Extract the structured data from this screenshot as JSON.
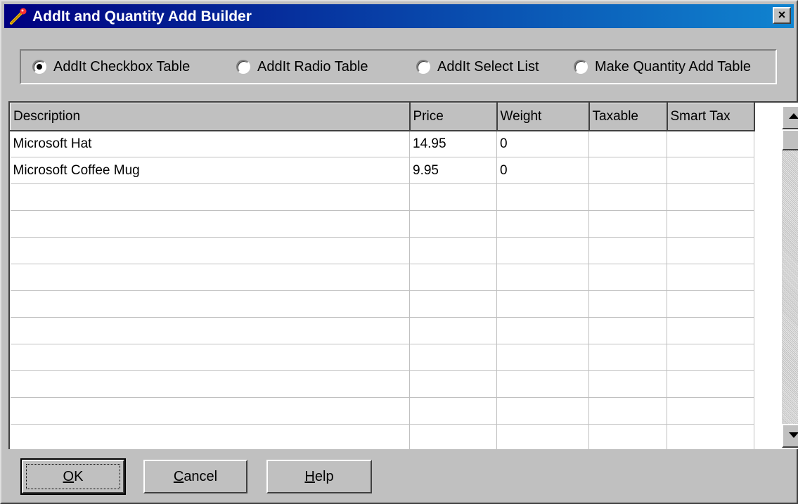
{
  "window": {
    "title": "AddIt and Quantity Add Builder",
    "close_label": "×"
  },
  "options": [
    {
      "label": "AddIt Checkbox Table",
      "selected": true
    },
    {
      "label": "AddIt Radio Table",
      "selected": false
    },
    {
      "label": "AddIt Select List",
      "selected": false
    },
    {
      "label": "Make Quantity Add Table",
      "selected": false
    }
  ],
  "grid": {
    "columns": [
      "Description",
      "Price",
      "Weight",
      "Taxable",
      "Smart Tax"
    ],
    "rows": [
      [
        "Microsoft Hat",
        "14.95",
        "0",
        "",
        ""
      ],
      [
        "Microsoft Coffee Mug",
        "9.95",
        "0",
        "",
        ""
      ],
      [
        "",
        "",
        "",
        "",
        ""
      ],
      [
        "",
        "",
        "",
        "",
        ""
      ],
      [
        "",
        "",
        "",
        "",
        ""
      ],
      [
        "",
        "",
        "",
        "",
        ""
      ],
      [
        "",
        "",
        "",
        "",
        ""
      ],
      [
        "",
        "",
        "",
        "",
        ""
      ],
      [
        "",
        "",
        "",
        "",
        ""
      ],
      [
        "",
        "",
        "",
        "",
        ""
      ],
      [
        "",
        "",
        "",
        "",
        ""
      ],
      [
        "",
        "",
        "",
        "",
        ""
      ]
    ]
  },
  "buttons": {
    "ok": "OK",
    "cancel": "Cancel",
    "help": "Help"
  }
}
